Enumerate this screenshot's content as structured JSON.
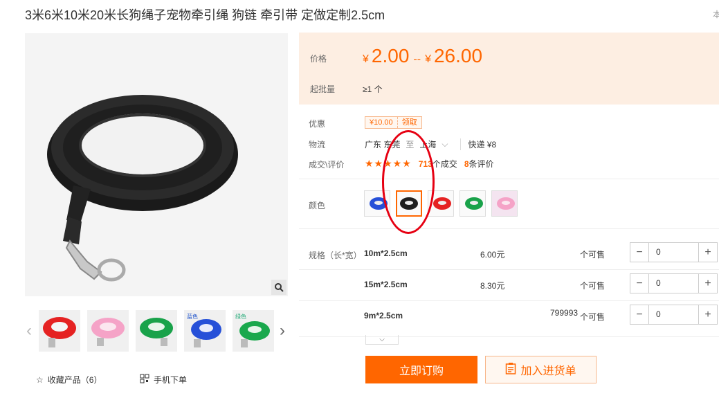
{
  "product": {
    "title": "3米6米10米20米长狗绳子宠物牵引绳 狗链 牵引带 定做定制2.5cm",
    "title_right": "本"
  },
  "gallery": {
    "thumb_tags": [
      "",
      "",
      "",
      "蓝色",
      "绿色"
    ]
  },
  "actions": {
    "favorite_label": "收藏产品（6）",
    "mobile_label": "手机下单"
  },
  "price": {
    "label": "价格",
    "currency": "¥",
    "low": "2.00",
    "separator": "--",
    "high": "26.00",
    "moq_label": "起批量",
    "moq_value": "≥1 个"
  },
  "coupon": {
    "label": "优惠",
    "amount": "¥10.00",
    "get": "领取"
  },
  "logistics": {
    "label": "物流",
    "from": "广东 东莞",
    "to_word": "至",
    "to": "上海",
    "express": "快递 ¥8"
  },
  "reviews": {
    "label": "成交\\评价",
    "stars": "★★★★★",
    "deals_num": "713",
    "deals_text": "个成交",
    "reviews_num": "8",
    "reviews_text": "条评价"
  },
  "color": {
    "label": "颜色"
  },
  "specs": {
    "label": "规格（长*宽）",
    "rows": [
      {
        "name": "10m*2.5cm",
        "price": "6.00元",
        "stock": "",
        "avail": "个可售",
        "qty": "0"
      },
      {
        "name": "15m*2.5cm",
        "price": "8.30元",
        "stock": "",
        "avail": "个可售",
        "qty": "0"
      },
      {
        "name": "9m*2.5cm",
        "price": "",
        "stock": "799993",
        "avail": "个可售",
        "qty": "0"
      }
    ]
  },
  "buttons": {
    "buy": "立即订购",
    "cart": "加入进货单"
  },
  "colors": {
    "accent": "#ff6600",
    "annotation": "#e60012"
  }
}
